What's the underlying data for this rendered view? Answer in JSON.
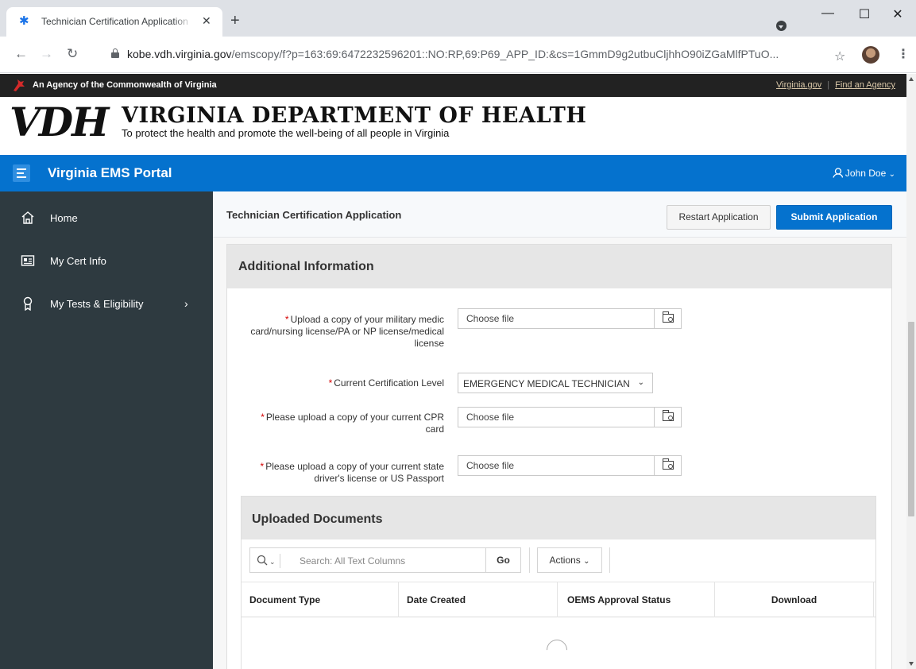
{
  "browser": {
    "tab_title": "Technician Certification Application",
    "tab_favicon": "star-of-life-icon",
    "url_host": "kobe.vdh.virginia.gov",
    "url_path": "/emscopy/f?p=163:69:6472232596201::NO:RP,69:P69_APP_ID:&cs=1GmmD9g2utbuCljhhO90iZGaMlfPTuO..."
  },
  "agency_bar": {
    "text": "An Agency of the Commonwealth of Virginia",
    "link_virginia": "Virginia.gov",
    "link_find": "Find an Agency"
  },
  "header": {
    "logo": "VDH",
    "title": "VIRGINIA DEPARTMENT OF HEALTH",
    "subtitle": "To protect the health and promote the well-being of all people in Virginia"
  },
  "portal": {
    "title": "Virginia EMS Portal",
    "user": "John Doe"
  },
  "sidebar": {
    "items": [
      {
        "label": "Home",
        "icon": "home-icon"
      },
      {
        "label": "My Cert Info",
        "icon": "id-card-icon"
      },
      {
        "label": "My Tests & Eligibility",
        "icon": "award-icon"
      }
    ]
  },
  "page": {
    "title": "Technician Certification Application",
    "restart_label": "Restart Application",
    "submit_label": "Submit Application"
  },
  "additional_info": {
    "title": "Additional Information",
    "required_marker": "*",
    "fields": [
      {
        "label": "Upload a copy of your military medic card/nursing license/PA or NP license/medical license",
        "placeholder": "Choose file"
      },
      {
        "label": "Current Certification Level",
        "value": "EMERGENCY MEDICAL TECHNICIAN"
      },
      {
        "label": "Please upload a copy of your current CPR card",
        "placeholder": "Choose file"
      },
      {
        "label": "Please upload a copy of your current state driver's license or US Passport",
        "placeholder": "Choose file"
      }
    ]
  },
  "uploaded_documents": {
    "title": "Uploaded Documents",
    "search_placeholder": "Search: All Text Columns",
    "go_label": "Go",
    "actions_label": "Actions",
    "columns": [
      "Document Type",
      "Date Created",
      "OEMS Approval Status",
      "Download"
    ]
  }
}
